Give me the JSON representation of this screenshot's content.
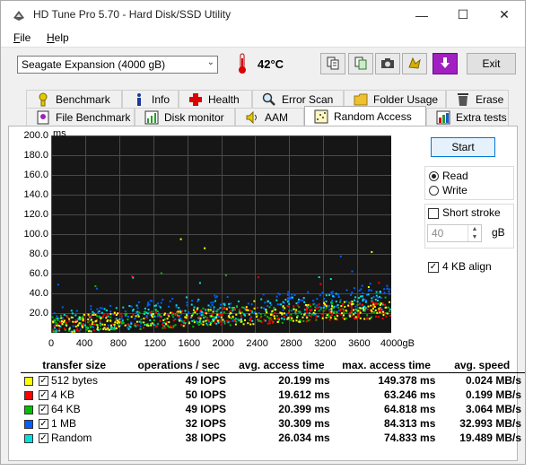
{
  "window": {
    "title": "HD Tune Pro 5.70 - Hard Disk/SSD Utility",
    "controls": {
      "minimize": "—",
      "maximize": "☐",
      "close": "✕"
    }
  },
  "menu": {
    "file": "File",
    "help": "Help"
  },
  "toolbar": {
    "drive": "Seagate Expansion (4000 gB)",
    "temperature": "42°C",
    "exit_label": "Exit",
    "icons": [
      "copy-info-icon",
      "copy-text-icon",
      "screenshot-icon",
      "options-icon",
      "download-icon"
    ]
  },
  "tabs_row1": [
    {
      "label": "Benchmark",
      "icon": "benchmark-icon"
    },
    {
      "label": "Info",
      "icon": "info-icon"
    },
    {
      "label": "Health",
      "icon": "health-icon"
    },
    {
      "label": "Error Scan",
      "icon": "error-scan-icon"
    },
    {
      "label": "Folder Usage",
      "icon": "folder-icon"
    },
    {
      "label": "Erase",
      "icon": "erase-icon"
    }
  ],
  "tabs_row2": [
    {
      "label": "File Benchmark",
      "icon": "file-benchmark-icon"
    },
    {
      "label": "Disk monitor",
      "icon": "disk-monitor-icon"
    },
    {
      "label": "AAM",
      "icon": "aam-icon"
    },
    {
      "label": "Random Access",
      "icon": "random-access-icon",
      "active": true
    },
    {
      "label": "Extra tests",
      "icon": "extra-tests-icon"
    }
  ],
  "controls": {
    "start_label": "Start",
    "read_label": "Read",
    "write_label": "Write",
    "mode_selected": "Read",
    "short_stroke_label": "Short stroke",
    "short_stroke_checked": false,
    "short_stroke_value": "40",
    "short_stroke_unit": "gB",
    "align_label": "4 KB align",
    "align_checked": true
  },
  "chart_data": {
    "type": "scatter",
    "ylabel": "ms",
    "xlabel": "gB",
    "ylim": [
      0,
      200
    ],
    "xlim": [
      0,
      4000
    ],
    "y_ticks": [
      "200.0",
      "180.0",
      "160.0",
      "140.0",
      "120.0",
      "100.0",
      "80.0",
      "60.0",
      "40.0",
      "20.0"
    ],
    "x_ticks": [
      "0",
      "400",
      "800",
      "1200",
      "1600",
      "2000",
      "2400",
      "2800",
      "3200",
      "3600",
      "4000gB"
    ],
    "grid": true,
    "series": [
      {
        "name": "512 bytes",
        "color": "#ffff00",
        "avg_ms": 20.199,
        "max_ms": 149.378
      },
      {
        "name": "4 KB",
        "color": "#ff0000",
        "avg_ms": 19.612,
        "max_ms": 63.246
      },
      {
        "name": "64 KB",
        "color": "#00c000",
        "avg_ms": 20.399,
        "max_ms": 64.818
      },
      {
        "name": "1 MB",
        "color": "#0060ff",
        "avg_ms": 30.309,
        "max_ms": 84.313
      },
      {
        "name": "Random",
        "color": "#00e0e0",
        "avg_ms": 26.034,
        "max_ms": 74.833
      }
    ]
  },
  "results": {
    "headers": [
      "transfer size",
      "operations / sec",
      "avg. access time",
      "max. access time",
      "avg. speed"
    ],
    "rows": [
      {
        "color": "#ffff00",
        "size": "512 bytes",
        "ops": "49 IOPS",
        "avg": "20.199 ms",
        "max": "149.378 ms",
        "speed": "0.024 MB/s"
      },
      {
        "color": "#ff0000",
        "size": "4 KB",
        "ops": "50 IOPS",
        "avg": "19.612 ms",
        "max": "63.246 ms",
        "speed": "0.199 MB/s"
      },
      {
        "color": "#00c000",
        "size": "64 KB",
        "ops": "49 IOPS",
        "avg": "20.399 ms",
        "max": "64.818 ms",
        "speed": "3.064 MB/s"
      },
      {
        "color": "#0060ff",
        "size": "1 MB",
        "ops": "32 IOPS",
        "avg": "30.309 ms",
        "max": "84.313 ms",
        "speed": "32.993 MB/s"
      },
      {
        "color": "#00e0e0",
        "size": "Random",
        "ops": "38 IOPS",
        "avg": "26.034 ms",
        "max": "74.833 ms",
        "speed": "19.489 MB/s"
      }
    ]
  }
}
